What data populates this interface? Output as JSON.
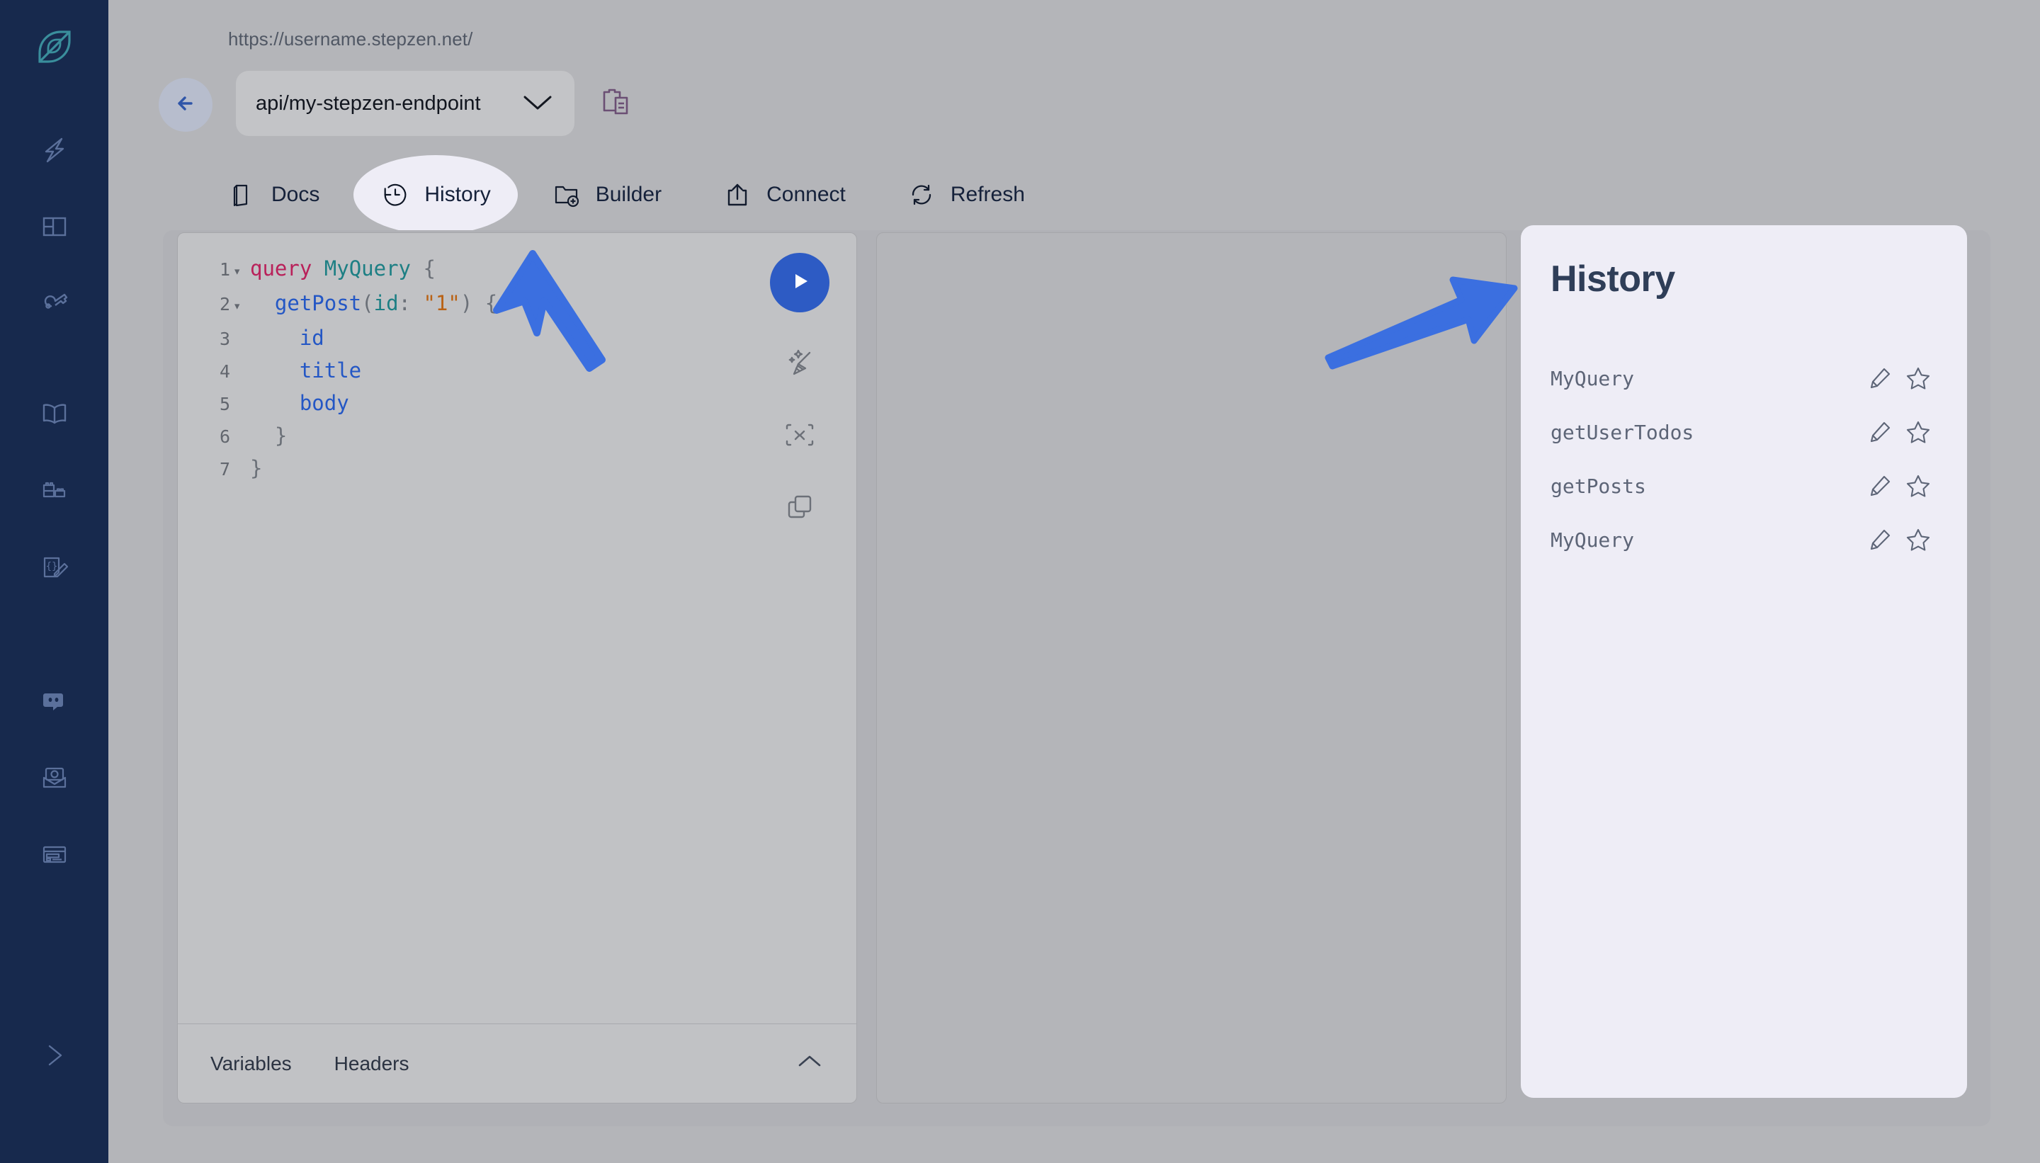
{
  "app": {
    "brand_dark": "#17294d",
    "accent_blue": "#2d5bc4",
    "annotation_blue": "#3b6fe0",
    "panel_lavender": "#eeedf6",
    "canvas_gray": "#b4b5b9"
  },
  "rail": {
    "logo_name": "stepzen-logo-icon",
    "items": [
      {
        "icon": "bolt-icon",
        "name": "sidebar-item-activity"
      },
      {
        "icon": "dashboard-grid-icon",
        "name": "sidebar-item-dashboard"
      },
      {
        "icon": "key-icon",
        "name": "sidebar-item-keys"
      },
      {
        "icon": "open-book-icon",
        "name": "sidebar-item-docs"
      },
      {
        "icon": "blocks-icon",
        "name": "sidebar-item-samples"
      },
      {
        "icon": "code-file-pencil-icon",
        "name": "sidebar-item-schema"
      },
      {
        "icon": "discord-icon",
        "name": "sidebar-item-discord"
      },
      {
        "icon": "email-at-icon",
        "name": "sidebar-item-contact"
      },
      {
        "icon": "card-layout-icon",
        "name": "sidebar-item-account"
      }
    ],
    "expand_icon": "chevron-right-icon"
  },
  "header": {
    "url_prefix": "https://username.stepzen.net/",
    "back_icon": "arrow-left-icon",
    "endpoint_value": "api/my-stepzen-endpoint",
    "endpoint_caret_icon": "chevron-down-icon",
    "copy_icon": "clipboard-copy-icon"
  },
  "tabs": [
    {
      "label": "Docs",
      "icon": "book-icon",
      "active": false
    },
    {
      "label": "History",
      "icon": "clock-rewind-icon",
      "active": true
    },
    {
      "label": "Builder",
      "icon": "folder-plus-icon",
      "active": false
    },
    {
      "label": "Connect",
      "icon": "share-upload-icon",
      "active": false
    },
    {
      "label": "Refresh",
      "icon": "refresh-icon",
      "active": false
    }
  ],
  "editor": {
    "lines": [
      {
        "num": "1",
        "fold": "▾",
        "indent": 0,
        "tokens": [
          {
            "t": "query",
            "c": "tok-kw"
          },
          {
            "t": " ",
            "c": "tok-punc"
          },
          {
            "t": "MyQuery",
            "c": "tok-name"
          },
          {
            "t": " {",
            "c": "tok-punc"
          }
        ]
      },
      {
        "num": "2",
        "fold": "▾",
        "indent": 1,
        "tokens": [
          {
            "t": "getPost",
            "c": "tok-field"
          },
          {
            "t": "(",
            "c": "tok-punc"
          },
          {
            "t": "id",
            "c": "tok-arg"
          },
          {
            "t": ": ",
            "c": "tok-punc"
          },
          {
            "t": "\"1\"",
            "c": "tok-str"
          },
          {
            "t": ") {",
            "c": "tok-punc"
          }
        ]
      },
      {
        "num": "3",
        "fold": "",
        "indent": 2,
        "tokens": [
          {
            "t": "id",
            "c": "tok-field"
          }
        ]
      },
      {
        "num": "4",
        "fold": "",
        "indent": 2,
        "tokens": [
          {
            "t": "title",
            "c": "tok-field"
          }
        ]
      },
      {
        "num": "5",
        "fold": "",
        "indent": 2,
        "tokens": [
          {
            "t": "body",
            "c": "tok-field"
          }
        ]
      },
      {
        "num": "6",
        "fold": "",
        "indent": 1,
        "tokens": [
          {
            "t": "}",
            "c": "tok-punc"
          }
        ]
      },
      {
        "num": "7",
        "fold": "",
        "indent": 0,
        "tokens": [
          {
            "t": "}",
            "c": "tok-punc"
          }
        ]
      }
    ],
    "tools": [
      {
        "name": "execute-query-button",
        "icon": "play-icon"
      },
      {
        "name": "prettify-button",
        "icon": "magic-broom-icon"
      },
      {
        "name": "merge-fragments-button",
        "icon": "merge-icon"
      },
      {
        "name": "copy-query-button",
        "icon": "copy-icon"
      }
    ],
    "footer_tabs": [
      {
        "label": "Variables",
        "name": "tab-variables"
      },
      {
        "label": "Headers",
        "name": "tab-headers"
      }
    ],
    "collapse_icon": "chevron-up-icon"
  },
  "response": {
    "content": ""
  },
  "history": {
    "title": "History",
    "edit_icon": "pencil-icon",
    "star_icon": "star-outline-icon",
    "items": [
      {
        "label": "MyQuery"
      },
      {
        "label": "getUserTodos"
      },
      {
        "label": "getPosts"
      },
      {
        "label": "MyQuery"
      }
    ]
  },
  "annotations": [
    {
      "name": "arrow-pointing-to-history-tab"
    },
    {
      "name": "arrow-pointing-to-history-panel"
    }
  ]
}
